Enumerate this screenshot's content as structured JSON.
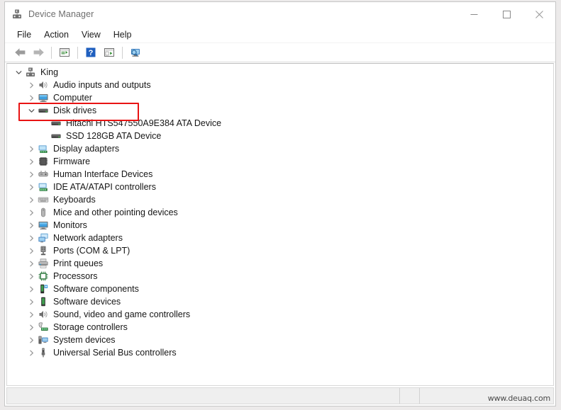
{
  "window": {
    "title": "Device Manager",
    "title_icon": "device-manager-icon",
    "controls": [
      {
        "name": "minimize-button",
        "glyph": "minimize-icon"
      },
      {
        "name": "maximize-button",
        "glyph": "maximize-icon"
      },
      {
        "name": "close-button",
        "glyph": "close-icon"
      }
    ]
  },
  "menubar": {
    "items": [
      {
        "label": "File"
      },
      {
        "label": "Action"
      },
      {
        "label": "View"
      },
      {
        "label": "Help"
      }
    ]
  },
  "toolbar": {
    "buttons": [
      {
        "name": "back-button",
        "icon": "back-arrow-icon"
      },
      {
        "name": "forward-button",
        "icon": "forward-arrow-icon"
      },
      {
        "name": "properties-button",
        "icon": "properties-icon"
      },
      {
        "name": "help-button",
        "icon": "help-question-icon"
      },
      {
        "name": "update-driver-button",
        "icon": "update-driver-icon"
      },
      {
        "name": "scan-hardware-button",
        "icon": "scan-hardware-icon"
      }
    ]
  },
  "tree": {
    "root": {
      "label": "King",
      "icon": "computer-root-icon",
      "expanded": true
    },
    "nodes": [
      {
        "label": "Audio inputs and outputs",
        "icon": "speaker-icon",
        "expanded": false,
        "level": 1,
        "highlighted": false
      },
      {
        "label": "Computer",
        "icon": "monitor-icon",
        "expanded": false,
        "level": 1,
        "highlighted": false
      },
      {
        "label": "Disk drives",
        "icon": "disk-drive-icon",
        "expanded": true,
        "level": 1,
        "highlighted": true
      },
      {
        "label": "Hitachi HTS547550A9E384 ATA Device",
        "icon": "disk-drive-icon",
        "expanded": null,
        "level": 2,
        "highlighted": false
      },
      {
        "label": "SSD 128GB ATA Device",
        "icon": "disk-drive-icon",
        "expanded": null,
        "level": 2,
        "highlighted": false
      },
      {
        "label": "Display adapters",
        "icon": "display-adapter-icon",
        "expanded": false,
        "level": 1,
        "highlighted": false
      },
      {
        "label": "Firmware",
        "icon": "firmware-icon",
        "expanded": false,
        "level": 1,
        "highlighted": false
      },
      {
        "label": "Human Interface Devices",
        "icon": "hid-icon",
        "expanded": false,
        "level": 1,
        "highlighted": false
      },
      {
        "label": "IDE ATA/ATAPI controllers",
        "icon": "ide-controller-icon",
        "expanded": false,
        "level": 1,
        "highlighted": false
      },
      {
        "label": "Keyboards",
        "icon": "keyboard-icon",
        "expanded": false,
        "level": 1,
        "highlighted": false
      },
      {
        "label": "Mice and other pointing devices",
        "icon": "mouse-icon",
        "expanded": false,
        "level": 1,
        "highlighted": false
      },
      {
        "label": "Monitors",
        "icon": "monitor-icon",
        "expanded": false,
        "level": 1,
        "highlighted": false
      },
      {
        "label": "Network adapters",
        "icon": "network-adapter-icon",
        "expanded": false,
        "level": 1,
        "highlighted": false
      },
      {
        "label": "Ports (COM & LPT)",
        "icon": "port-icon",
        "expanded": false,
        "level": 1,
        "highlighted": false
      },
      {
        "label": "Print queues",
        "icon": "printer-icon",
        "expanded": false,
        "level": 1,
        "highlighted": false
      },
      {
        "label": "Processors",
        "icon": "processor-icon",
        "expanded": false,
        "level": 1,
        "highlighted": false
      },
      {
        "label": "Software components",
        "icon": "software-component-icon",
        "expanded": false,
        "level": 1,
        "highlighted": false
      },
      {
        "label": "Software devices",
        "icon": "software-device-icon",
        "expanded": false,
        "level": 1,
        "highlighted": false
      },
      {
        "label": "Sound, video and game controllers",
        "icon": "speaker-icon",
        "expanded": false,
        "level": 1,
        "highlighted": false
      },
      {
        "label": "Storage controllers",
        "icon": "storage-controller-icon",
        "expanded": false,
        "level": 1,
        "highlighted": false
      },
      {
        "label": "System devices",
        "icon": "system-device-icon",
        "expanded": false,
        "level": 1,
        "highlighted": false
      },
      {
        "label": "Universal Serial Bus controllers",
        "icon": "usb-icon",
        "expanded": false,
        "level": 1,
        "highlighted": false
      }
    ]
  },
  "statusbar": {
    "text": "",
    "watermark": "www.deuaq.com"
  },
  "colors": {
    "highlight_red": "#e81313",
    "accent_blue": "#1f6fc4",
    "window_bg": "#ffffff",
    "status_bg": "#efefef"
  }
}
